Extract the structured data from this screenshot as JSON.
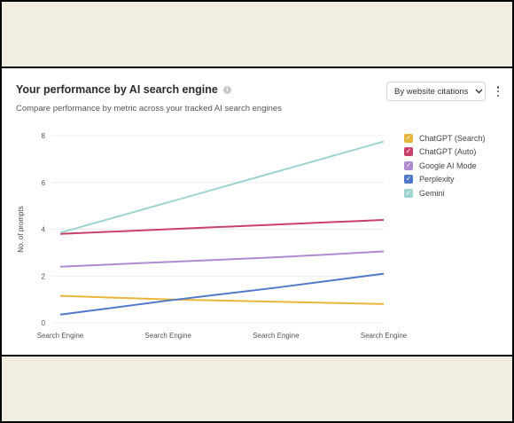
{
  "card": {
    "title": "Your performance by AI search engine",
    "info_icon": "info-icon",
    "subtitle": "Compare performance by metric across your tracked AI search engines",
    "dropdown": {
      "selected": "By website citations",
      "icon": "chevron-down-icon"
    },
    "more_icon": "more-vertical-icon"
  },
  "chart_data": {
    "type": "line",
    "ylabel": "No. of prompts",
    "xlabel": "",
    "categories": [
      "Search Engine",
      "Search Engine",
      "Search Engine",
      "Search Engine"
    ],
    "ylim": [
      0,
      8
    ],
    "yticks": [
      0,
      2,
      4,
      6,
      8
    ],
    "grid": true,
    "legend_position": "right",
    "series": [
      {
        "name": "ChatGPT (Search)",
        "color": "#e8b63a",
        "values": [
          1.15,
          1.0,
          0.9,
          0.8
        ]
      },
      {
        "name": "ChatGPT (Auto)",
        "color": "#c9406b",
        "values": [
          3.8,
          4.0,
          4.2,
          4.4
        ]
      },
      {
        "name": "Google AI Mode",
        "color": "#b08ad0",
        "values": [
          2.4,
          2.6,
          2.8,
          3.05
        ]
      },
      {
        "name": "Perplexity",
        "color": "#4f79c8",
        "values": [
          0.35,
          0.95,
          1.5,
          2.1
        ]
      },
      {
        "name": "Gemini",
        "color": "#9fd3d0",
        "values": [
          3.85,
          5.15,
          6.45,
          7.75
        ]
      }
    ]
  }
}
